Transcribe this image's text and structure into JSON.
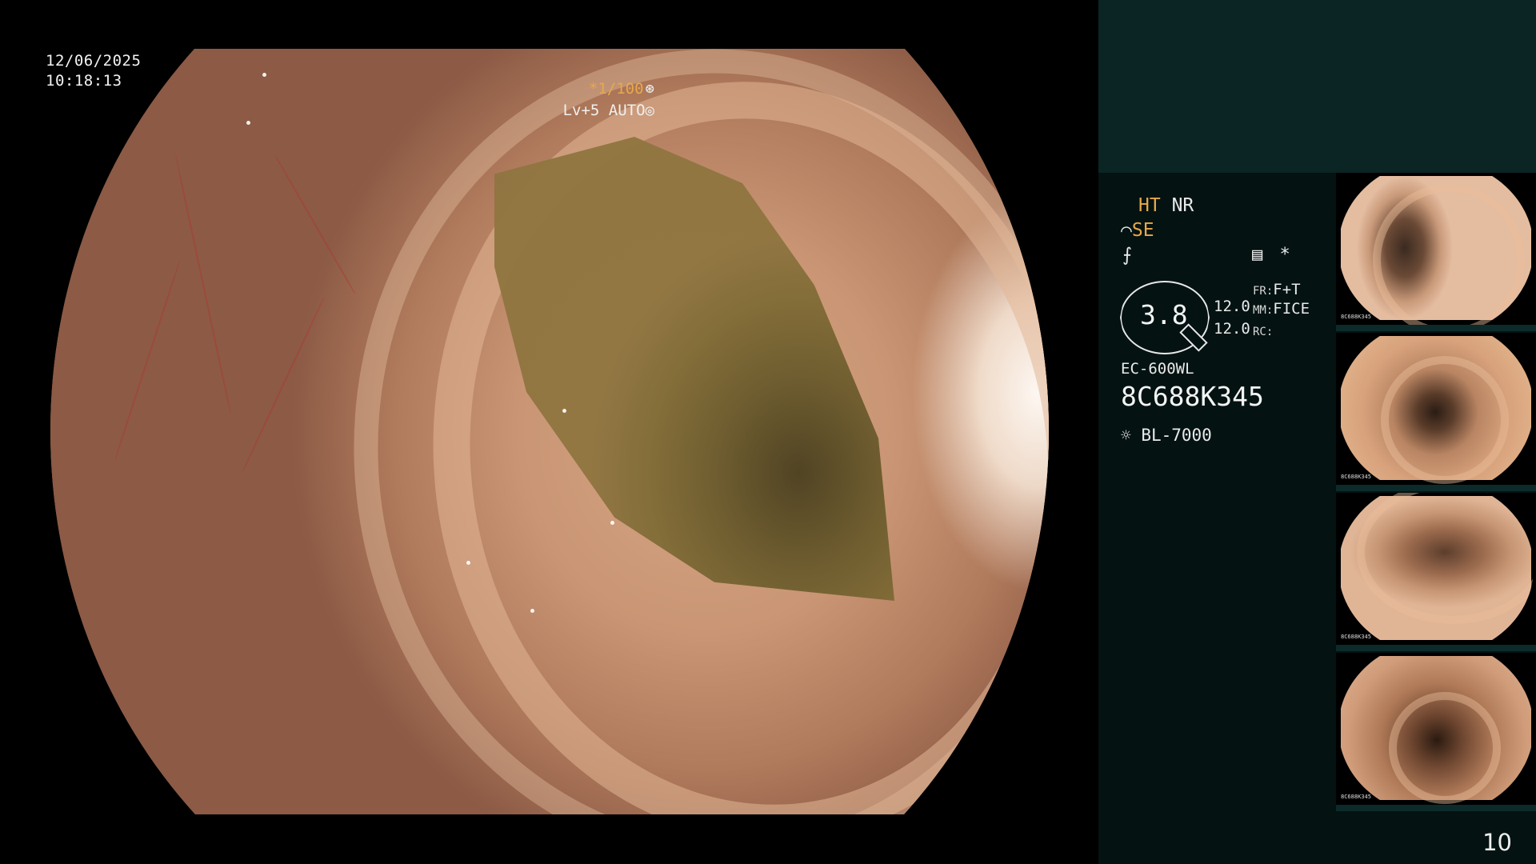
{
  "overlay": {
    "date": "12/06/2025",
    "time": "10:18:13",
    "shutter": "*1/100",
    "shutter_icon": "⊛",
    "level": "Lv+5 AUTO",
    "level_icon": "◎"
  },
  "settings": {
    "ht": "HT",
    "nr": "NR",
    "se_prefix": "⌒",
    "se": "SE",
    "f_icon": "⨍",
    "mode_icon": "▤",
    "mode_star": "*",
    "zoom": "3.8",
    "val1": "12.0",
    "val2": "12.0",
    "fr_label": "FR:",
    "fr_value": "F+T",
    "mm_label": "MM:",
    "mm_value": "FICE",
    "rc_label": "RC:",
    "model": "EC-600WL",
    "serial": "8C688K345",
    "light_icon": "☼",
    "light_source": "BL-7000"
  },
  "thumbnails": [
    {
      "caption": "8C688K345"
    },
    {
      "caption": "8C688K345"
    },
    {
      "caption": "8C688K345"
    },
    {
      "caption": "8C688K345"
    }
  ],
  "page_number": "10",
  "colors": {
    "accent_orange": "#e8a84a",
    "panel_bg": "#041212",
    "panel_top": "#0b2424"
  }
}
